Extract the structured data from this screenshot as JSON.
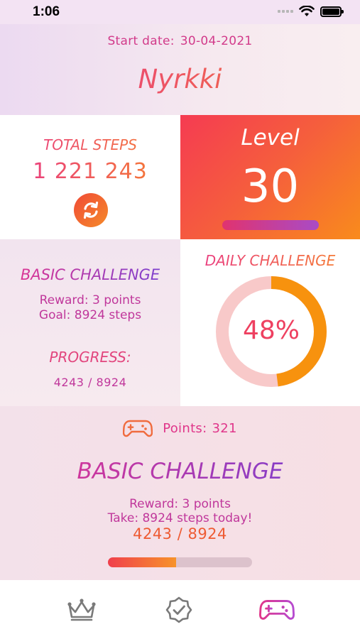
{
  "status_bar": {
    "time": "1:06"
  },
  "header": {
    "start_label": "Start date:",
    "start_date": "30-04-2021",
    "user_name": "Nyrkki"
  },
  "total_steps": {
    "title": "TOTAL STEPS",
    "value": "1 221 243"
  },
  "level": {
    "label": "Level",
    "value": "30"
  },
  "basic_challenge": {
    "title": "BASIC CHALLENGE",
    "reward": "Reward: 3 points",
    "goal": "Goal: 8924 steps",
    "progress_title": "PROGRESS:",
    "progress": "4243 / 8924"
  },
  "daily_challenge": {
    "title": "DAILY CHALLENGE",
    "percent_label": "48%",
    "percent": 48
  },
  "points_panel": {
    "label": "Points:",
    "value": "321",
    "title": "BASIC CHALLENGE",
    "reward": "Reward: 3 points",
    "instruction": "Take: 8924 steps today!",
    "progress": "4243 / 8924",
    "progress_fraction": 0.475
  },
  "tabs": [
    {
      "icon": "crown-icon",
      "active": false
    },
    {
      "icon": "badge-check-icon",
      "active": false
    },
    {
      "icon": "gamepad-icon",
      "active": true
    }
  ],
  "colors": {
    "accent_pink": "#e0368a",
    "accent_orange": "#f7832a",
    "ring_track": "#f8c9c9",
    "ring_fill": "#f7920e"
  }
}
